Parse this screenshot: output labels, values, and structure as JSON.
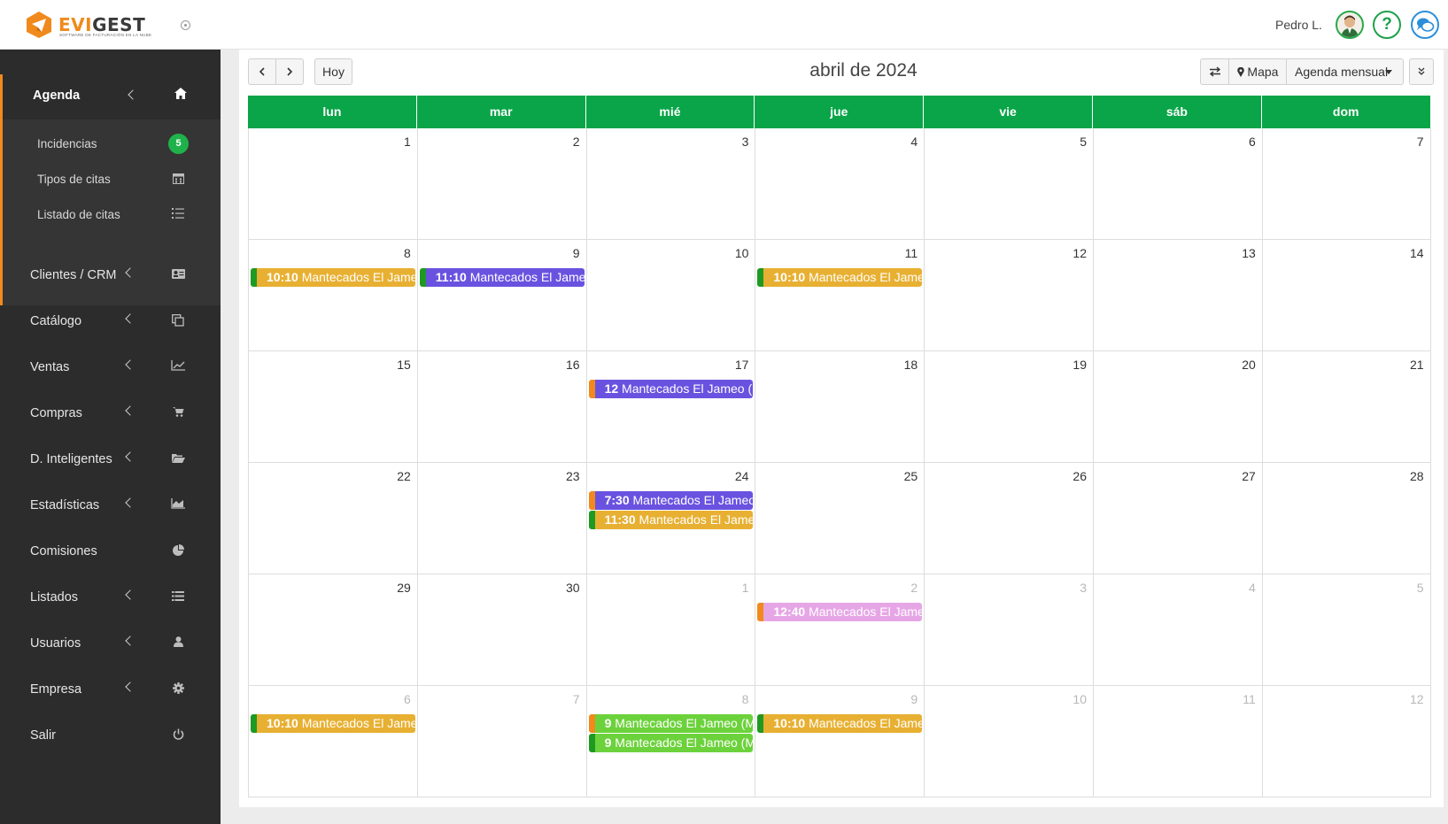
{
  "header": {
    "logo_text_a": "EVI",
    "logo_text_b": "GEST",
    "logo_sub": "SOFTWARE DE FACTURACIÓN EN LA NUBE",
    "user_name": "Pedro L."
  },
  "sidebar": {
    "items": [
      {
        "label": "Agenda",
        "icon": "home-icon"
      },
      {
        "label": "Clientes / CRM",
        "icon": "id-card-icon"
      },
      {
        "label": "Catálogo",
        "icon": "copy-icon"
      },
      {
        "label": "Ventas",
        "icon": "line-chart-icon"
      },
      {
        "label": "Compras",
        "icon": "cart-icon"
      },
      {
        "label": "D. Inteligentes",
        "icon": "folder-open-icon"
      },
      {
        "label": "Estadísticas",
        "icon": "area-chart-icon"
      },
      {
        "label": "Comisiones",
        "icon": "pie-chart-icon"
      },
      {
        "label": "Listados",
        "icon": "list-icon"
      },
      {
        "label": "Usuarios",
        "icon": "user-icon"
      },
      {
        "label": "Empresa",
        "icon": "gear-icon"
      },
      {
        "label": "Salir",
        "icon": "power-icon"
      }
    ],
    "sub_items": [
      {
        "label": "Incidencias",
        "badge": "5"
      },
      {
        "label": "Tipos de citas",
        "icon": "calendar-icon"
      },
      {
        "label": "Listado de citas",
        "icon": "list-ul-icon"
      }
    ]
  },
  "toolbar": {
    "today_label": "Hoy",
    "title": "abril de 2024",
    "map_label": "Mapa",
    "view_label": "Agenda mensual"
  },
  "calendar": {
    "weekdays": [
      "lun",
      "mar",
      "mié",
      "jue",
      "vie",
      "sáb",
      "dom"
    ],
    "weeks": [
      {
        "days": [
          {
            "n": "1"
          },
          {
            "n": "2"
          },
          {
            "n": "3"
          },
          {
            "n": "4"
          },
          {
            "n": "5"
          },
          {
            "n": "6"
          },
          {
            "n": "7"
          }
        ]
      },
      {
        "days": [
          {
            "n": "8",
            "events": [
              {
                "time": "10:10",
                "title": " Mantecados El Jameo",
                "color": "#e8b032",
                "bar": "#1e9a22"
              }
            ]
          },
          {
            "n": "9",
            "events": [
              {
                "time": "11:10",
                "title": " Mantecados El Jameo",
                "color": "#6a52e0",
                "bar": "#1e9a22"
              }
            ]
          },
          {
            "n": "10"
          },
          {
            "n": "11",
            "events": [
              {
                "time": "10:10",
                "title": " Mantecados El Jameo",
                "color": "#e8b032",
                "bar": "#1e9a22"
              }
            ]
          },
          {
            "n": "12"
          },
          {
            "n": "13"
          },
          {
            "n": "14"
          }
        ]
      },
      {
        "days": [
          {
            "n": "15"
          },
          {
            "n": "16"
          },
          {
            "n": "17",
            "events": [
              {
                "time": "12",
                "title": " Mantecados El Jameo (M",
                "color": "#6a52e0",
                "bar": "#f08a1c"
              }
            ]
          },
          {
            "n": "18"
          },
          {
            "n": "19"
          },
          {
            "n": "20"
          },
          {
            "n": "21"
          }
        ]
      },
      {
        "days": [
          {
            "n": "22"
          },
          {
            "n": "23"
          },
          {
            "n": "24",
            "events": [
              {
                "time": "7:30",
                "title": " Mantecados El Jameo",
                "color": "#6a52e0",
                "bar": "#f08a1c"
              },
              {
                "time": "11:30",
                "title": " Mantecados El Jameo",
                "color": "#e8b032",
                "bar": "#1e9a22"
              }
            ]
          },
          {
            "n": "25"
          },
          {
            "n": "26"
          },
          {
            "n": "27"
          },
          {
            "n": "28"
          }
        ]
      },
      {
        "days": [
          {
            "n": "29"
          },
          {
            "n": "30"
          },
          {
            "n": "1",
            "other": true
          },
          {
            "n": "2",
            "other": true,
            "events": [
              {
                "time": "12:40",
                "title": " Mantecados El Jameo",
                "color": "#e6a6e6",
                "bar": "#f08a1c"
              }
            ]
          },
          {
            "n": "3",
            "other": true
          },
          {
            "n": "4",
            "other": true
          },
          {
            "n": "5",
            "other": true
          }
        ]
      },
      {
        "days": [
          {
            "n": "6",
            "other": true,
            "events": [
              {
                "time": "10:10",
                "title": " Mantecados El Jameo",
                "color": "#e8b032",
                "bar": "#1e9a22"
              }
            ]
          },
          {
            "n": "7",
            "other": true
          },
          {
            "n": "8",
            "other": true,
            "events": [
              {
                "time": "9",
                "title": " Mantecados El Jameo (Ma",
                "color": "#6cd23c",
                "bar": "#f08a1c"
              },
              {
                "time": "9",
                "title": " Mantecados El Jameo (Ma",
                "color": "#6cd23c",
                "bar": "#1e9a22"
              }
            ]
          },
          {
            "n": "9",
            "other": true,
            "events": [
              {
                "time": "10:10",
                "title": " Mantecados El Jameo",
                "color": "#e8b032",
                "bar": "#1e9a22"
              }
            ]
          },
          {
            "n": "10",
            "other": true
          },
          {
            "n": "11",
            "other": true
          },
          {
            "n": "12",
            "other": true
          }
        ]
      }
    ]
  }
}
